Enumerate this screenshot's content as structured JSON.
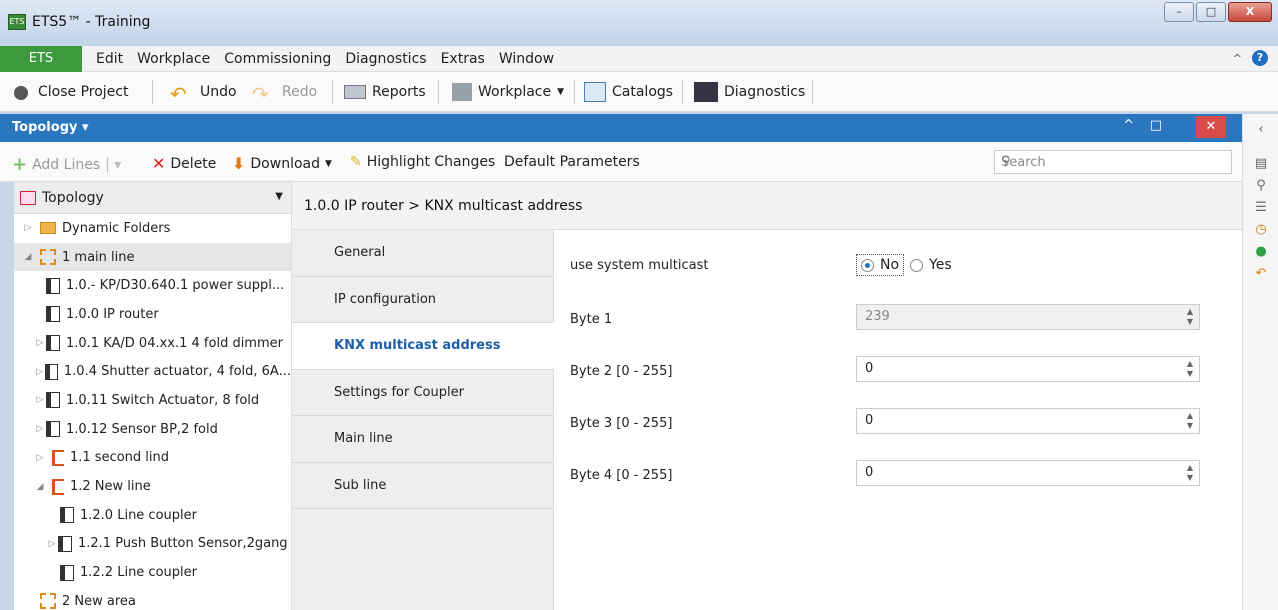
{
  "window": {
    "title": "ETS5™ - Training",
    "app_icon": "ets-app-icon"
  },
  "menu": {
    "brand": "ETS",
    "items": [
      "Edit",
      "Workplace",
      "Commissioning",
      "Diagnostics",
      "Extras",
      "Window"
    ]
  },
  "toolbar": {
    "close_project": "Close Project",
    "undo": "Undo",
    "redo": "Redo",
    "reports": "Reports",
    "workplace": "Workplace",
    "catalogs": "Catalogs",
    "diagnostics": "Diagnostics"
  },
  "panel": {
    "title": "Topology"
  },
  "subtoolbar": {
    "add_lines": "Add Lines",
    "delete": "Delete",
    "download": "Download",
    "highlight": "Highlight Changes",
    "default_params": "Default Parameters",
    "search_placeholder": "Search"
  },
  "tree": {
    "header": "Topology",
    "items": [
      "Dynamic Folders",
      "1 main line",
      "1.0.- KP/D30.640.1 power suppl...",
      "1.0.0 IP router",
      "1.0.1 KA/D 04.xx.1 4 fold dimmer",
      "1.0.4 Shutter actuator, 4 fold, 6A...",
      "1.0.11 Switch Actuator, 8 fold",
      "1.0.12 Sensor BP,2 fold",
      "1.1 second lind",
      "1.2 New line",
      "1.2.0 Line coupler",
      "1.2.1 Push Button Sensor,2gang",
      "1.2.2 Line coupler",
      "2 New area"
    ]
  },
  "content": {
    "breadcrumb": "1.0.0 IP router > KNX multicast address",
    "tabs": [
      "General",
      "IP configuration",
      "KNX multicast address",
      "Settings for Coupler",
      "Main line",
      "Sub line"
    ],
    "params": {
      "use_system_multicast": "use system multicast",
      "no": "No",
      "yes": "Yes",
      "byte1_label": "Byte 1",
      "byte1_value": "239",
      "byte2_label": "Byte 2 [0 - 255]",
      "byte2_value": "0",
      "byte3_label": "Byte 3 [0 - 255]",
      "byte3_value": "0",
      "byte4_label": "Byte 4 [0 - 255]",
      "byte4_value": "0"
    }
  }
}
